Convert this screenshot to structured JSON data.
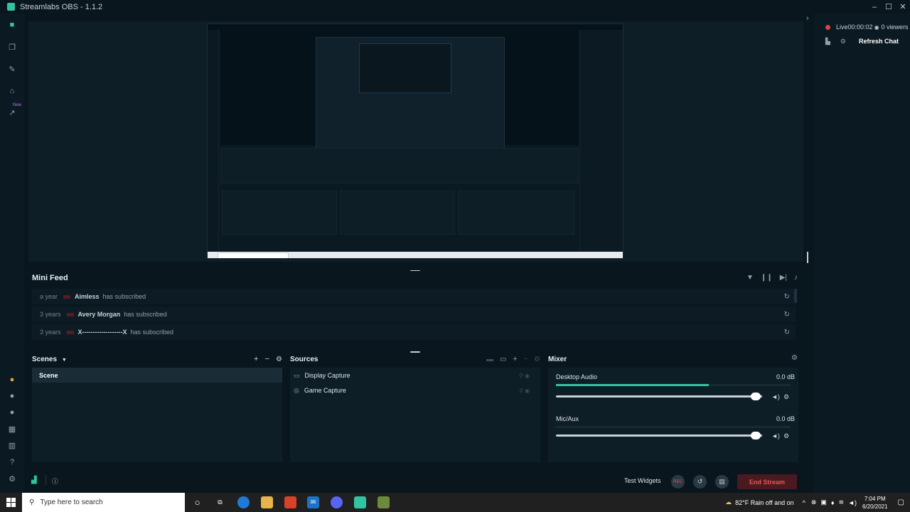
{
  "window": {
    "title": "Streamlabs OBS - 1.1.2"
  },
  "nav": {
    "new_badge": "New"
  },
  "stream_status": {
    "live_label": "Live",
    "elapsed": "00:00:02",
    "viewers": "0 viewers"
  },
  "chat": {
    "refresh_label": "Refresh Chat"
  },
  "mini_feed": {
    "title": "Mini Feed",
    "events": [
      {
        "time": "a year",
        "name": "Aimless",
        "action": "has subscribed"
      },
      {
        "time": "3 years",
        "name": "Avery Morgan",
        "action": "has subscribed"
      },
      {
        "time": "3 years",
        "name": "X-------------------X",
        "action": "has subscribed"
      }
    ]
  },
  "scenes": {
    "title": "Scenes",
    "items": [
      "Scene"
    ]
  },
  "sources": {
    "title": "Sources",
    "items": [
      "Display Capture",
      "Game Capture"
    ]
  },
  "mixer": {
    "title": "Mixer",
    "channels": [
      {
        "name": "Desktop Audio",
        "level": "0.0 dB",
        "meter_fill": 0.65,
        "volume": 0.97
      },
      {
        "name": "Mic/Aux",
        "level": "0.0 dB",
        "meter_fill": 0.0,
        "volume": 0.97
      }
    ]
  },
  "footer": {
    "test_widgets": "Test Widgets",
    "rec_label": "REC",
    "end_stream": "End Stream"
  },
  "taskbar": {
    "search_placeholder": "Type here to search",
    "weather": "82°F  Rain off and on",
    "time": "7:04 PM",
    "date": "6/20/2021"
  },
  "colors": {
    "accent": "#31c3a2",
    "live_red": "#e04343",
    "end_stream_bg": "#4a1a20"
  }
}
